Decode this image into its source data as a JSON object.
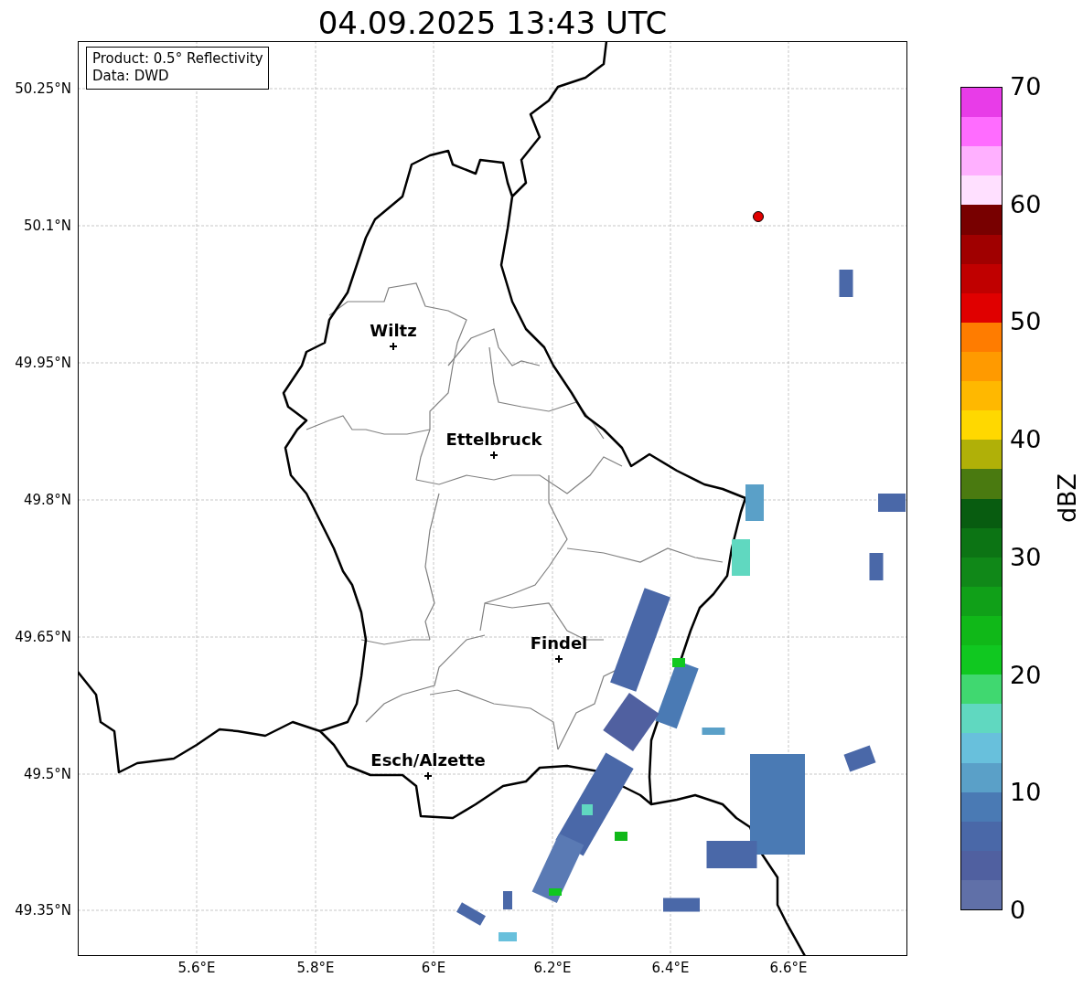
{
  "title": "04.09.2025 13:43 UTC",
  "info_box": [
    "Product: 0.5° Reflectivity",
    "Data: DWD"
  ],
  "map": {
    "cities": [
      {
        "name": "Wiltz"
      },
      {
        "name": "Ettelbruck"
      },
      {
        "name": "Findel"
      },
      {
        "name": "Esch/Alzette"
      }
    ],
    "latitude_labels": [
      "50.25°N",
      "50.1°N",
      "49.95°N",
      "49.8°N",
      "49.65°N",
      "49.5°N",
      "49.35°N"
    ],
    "longitude_labels": [
      "5.6°E",
      "5.8°E",
      "6°E",
      "6.2°E",
      "6.4°E",
      "6.6°E"
    ]
  },
  "colorbar": {
    "label": "dBZ",
    "ticks": [
      "70",
      "60",
      "50",
      "40",
      "30",
      "20",
      "10",
      "0"
    ],
    "segments": [
      {
        "color": "#e83ce8"
      },
      {
        "color": "#ff6cff"
      },
      {
        "color": "#ffb0ff"
      },
      {
        "color": "#ffe0ff"
      },
      {
        "color": "#780000"
      },
      {
        "color": "#a00000"
      },
      {
        "color": "#c00000"
      },
      {
        "color": "#e00000"
      },
      {
        "color": "#ff7c00"
      },
      {
        "color": "#ff9a00"
      },
      {
        "color": "#ffb800"
      },
      {
        "color": "#ffd800"
      },
      {
        "color": "#b0b008"
      },
      {
        "color": "#4a7a10"
      },
      {
        "color": "#085c10"
      },
      {
        "color": "#0c7414"
      },
      {
        "color": "#108818"
      },
      {
        "color": "#10a018"
      },
      {
        "color": "#10b818"
      },
      {
        "color": "#10c820"
      },
      {
        "color": "#40d870"
      },
      {
        "color": "#60d8c0"
      },
      {
        "color": "#68c0dc"
      },
      {
        "color": "#5aa0c8"
      },
      {
        "color": "#4a7ab4"
      },
      {
        "color": "#4a68a8"
      },
      {
        "color": "#5060a0"
      },
      {
        "color": "#6070a8"
      }
    ]
  }
}
